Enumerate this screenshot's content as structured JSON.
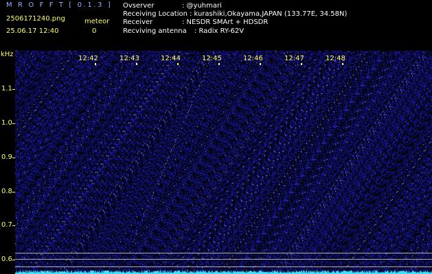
{
  "header": {
    "app_title": "M R O F F T [ 0.1.3 ]",
    "file_name": "2506171240.png",
    "date_time": "25.06.17 12:40",
    "meteor_label": "meteor",
    "meteor_count": "0"
  },
  "station": {
    "observer_label": "Ovserver",
    "observer_value": ": @yuhmari",
    "location_label": "Receiving Location",
    "location_value": ": kurashiki,Okayama,JAPAN (133.77E, 34.58N)",
    "receiver_label": "Receiver",
    "receiver_value": ": NESDR SMArt + HDSDR",
    "antenna_label": "Recviving antenna",
    "antenna_value": ": Radix RY-62V"
  },
  "axis": {
    "unit": "kHz",
    "y_ticks": [
      "1.1",
      "1.0",
      "0.9",
      "0.8",
      "0.7",
      "0.6"
    ],
    "x_ticks": [
      "12:42",
      "12:43",
      "12:44",
      "12:45",
      "12:46",
      "12:47",
      "12:48"
    ]
  },
  "colors": {
    "background": "#000000",
    "noise": "#1a1ac8",
    "signal": "#c8c8ff",
    "label": "#ffff66",
    "baseline": "#40e0ff"
  }
}
